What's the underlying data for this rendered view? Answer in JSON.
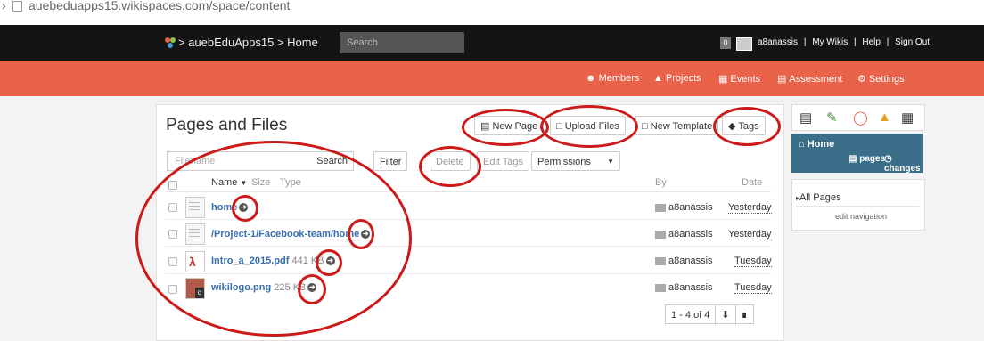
{
  "browser": {
    "url": "auebeduapps15.wikispaces.com/space/content"
  },
  "header": {
    "breadcrumb": "> auebEduApps15 > Home",
    "search_placeholder": "Search",
    "notif_count": "0",
    "user_links": [
      "a8anassis",
      "|",
      "My Wikis",
      "|",
      "Help",
      "|",
      "Sign Out"
    ]
  },
  "nav": {
    "members": "Members",
    "projects": "Projects",
    "events": "Events",
    "assessment": "Assessment",
    "settings": "Settings"
  },
  "main": {
    "title": "Pages and Files",
    "new_page": "New Page",
    "upload_files": "Upload Files",
    "new_template": "New Template",
    "tags": "Tags",
    "filter_placeholder": "Filename",
    "search_button": "Search",
    "filter_button": "Filter",
    "delete_button": "Delete",
    "edit_tags_button": "Edit Tags",
    "permissions_button": "Permissions",
    "columns": {
      "name": "Name",
      "size": "Size",
      "type": "Type",
      "by": "By",
      "date": "Date"
    },
    "rows": [
      {
        "name": "home",
        "size": "",
        "by": "a8anassis",
        "date": "Yesterday"
      },
      {
        "name": "/Project-1/Facebook-team/home",
        "size": "",
        "by": "a8anassis",
        "date": "Yesterday"
      },
      {
        "name": "Intro_a_2015.pdf",
        "size": "441 KB",
        "by": "a8anassis",
        "date": "Tuesday"
      },
      {
        "name": "wikilogo.png",
        "size": "225 KB",
        "by": "a8anassis",
        "date": "Tuesday"
      }
    ],
    "pager": "1 - 4 of 4"
  },
  "sidebar": {
    "home_title": "Home",
    "pages_link": "pages",
    "changes_link": "changes",
    "all_pages": "All Pages",
    "edit_navigation": "edit navigation"
  },
  "colors": {
    "topbar": "#141414",
    "navbar": "#e8634a",
    "home_box": "#3b6e88",
    "link": "#3a6eb0",
    "annotation": "#cc1a1a"
  }
}
